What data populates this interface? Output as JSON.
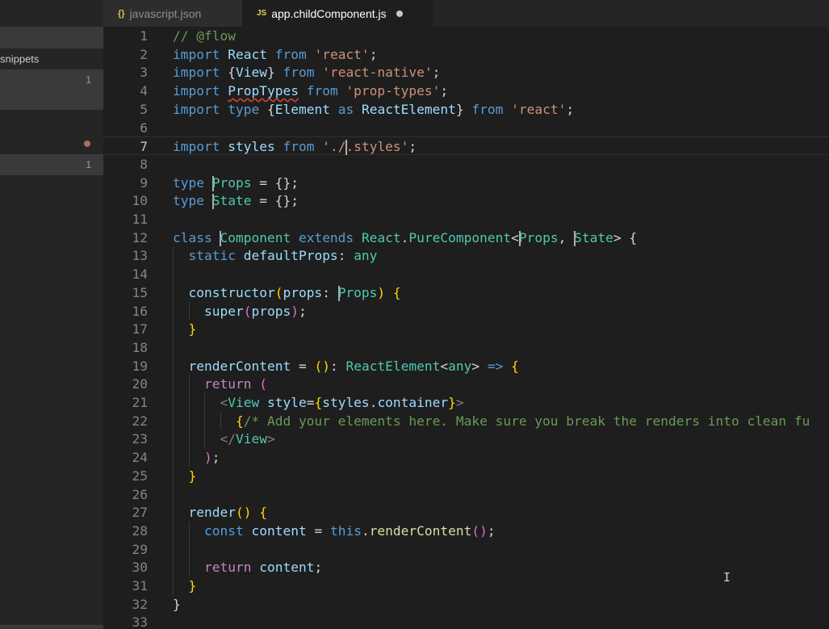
{
  "sidebar": {
    "items": [
      {
        "label": "",
        "badge": "",
        "dot": false
      },
      {
        "label": "snippets",
        "badge": "",
        "dot": false
      },
      {
        "label": "",
        "badge": "1",
        "dot": false
      },
      {
        "label": "",
        "badge": "",
        "dot": true
      },
      {
        "label": "",
        "badge": "1",
        "dot": false
      }
    ]
  },
  "tabs": [
    {
      "icon": "{}",
      "label": "javascript.json",
      "active": false
    },
    {
      "icon": "JS",
      "label": "app.childComponent.js",
      "active": true,
      "dirty": true
    }
  ],
  "editor": {
    "current_line": 7,
    "lines": [
      {
        "n": "1",
        "tokens": [
          [
            "c",
            "// @flow"
          ]
        ]
      },
      {
        "n": "2",
        "tokens": [
          [
            "k",
            "import"
          ],
          [
            "p",
            " "
          ],
          [
            "v",
            "React"
          ],
          [
            "p",
            " "
          ],
          [
            "k",
            "from"
          ],
          [
            "p",
            " "
          ],
          [
            "s",
            "'react'"
          ],
          [
            "p",
            ";"
          ]
        ]
      },
      {
        "n": "3",
        "tokens": [
          [
            "k",
            "import"
          ],
          [
            "p",
            " {"
          ],
          [
            "v",
            "View"
          ],
          [
            "p",
            "} "
          ],
          [
            "k",
            "from"
          ],
          [
            "p",
            " "
          ],
          [
            "s",
            "'react-native'"
          ],
          [
            "p",
            ";"
          ]
        ]
      },
      {
        "n": "4",
        "tokens": [
          [
            "k",
            "import"
          ],
          [
            "p",
            " "
          ],
          [
            "vq",
            "PropTypes"
          ],
          [
            "p",
            " "
          ],
          [
            "k",
            "from"
          ],
          [
            "p",
            " "
          ],
          [
            "s",
            "'prop-types'"
          ],
          [
            "p",
            ";"
          ]
        ]
      },
      {
        "n": "5",
        "tokens": [
          [
            "k",
            "import"
          ],
          [
            "p",
            " "
          ],
          [
            "k",
            "type"
          ],
          [
            "p",
            " {"
          ],
          [
            "v",
            "Element"
          ],
          [
            "p",
            " "
          ],
          [
            "k",
            "as"
          ],
          [
            "p",
            " "
          ],
          [
            "v",
            "ReactElement"
          ],
          [
            "p",
            "} "
          ],
          [
            "k",
            "from"
          ],
          [
            "p",
            " "
          ],
          [
            "s",
            "'react'"
          ],
          [
            "p",
            ";"
          ]
        ]
      },
      {
        "n": "6",
        "tokens": []
      },
      {
        "n": "7",
        "tokens": [
          [
            "k",
            "import"
          ],
          [
            "p",
            " "
          ],
          [
            "v",
            "styles"
          ],
          [
            "p",
            " "
          ],
          [
            "k",
            "from"
          ],
          [
            "p",
            " "
          ],
          [
            "s",
            "'./"
          ],
          [
            "caret",
            ""
          ],
          [
            "s",
            ".styles'"
          ],
          [
            "p",
            ";"
          ]
        ]
      },
      {
        "n": "8",
        "tokens": []
      },
      {
        "n": "9",
        "tokens": [
          [
            "k",
            "type"
          ],
          [
            "p",
            " "
          ],
          [
            "caret",
            ""
          ],
          [
            "t",
            "Props"
          ],
          [
            "p",
            " = {};"
          ]
        ]
      },
      {
        "n": "10",
        "tokens": [
          [
            "k",
            "type"
          ],
          [
            "p",
            " "
          ],
          [
            "caret",
            ""
          ],
          [
            "t",
            "State"
          ],
          [
            "p",
            " = {};"
          ]
        ]
      },
      {
        "n": "11",
        "tokens": []
      },
      {
        "n": "12",
        "tokens": [
          [
            "k",
            "class"
          ],
          [
            "p",
            " "
          ],
          [
            "caret",
            ""
          ],
          [
            "t",
            "Component"
          ],
          [
            "p",
            " "
          ],
          [
            "k",
            "extends"
          ],
          [
            "p",
            " "
          ],
          [
            "t",
            "React"
          ],
          [
            "p",
            "."
          ],
          [
            "t",
            "PureComponent"
          ],
          [
            "p",
            "<"
          ],
          [
            "caret",
            ""
          ],
          [
            "t",
            "Props"
          ],
          [
            "p",
            ", "
          ],
          [
            "caret",
            ""
          ],
          [
            "t",
            "State"
          ],
          [
            "p",
            "> {"
          ]
        ]
      },
      {
        "n": "13",
        "tokens": [
          [
            "p",
            "  "
          ],
          [
            "k",
            "static"
          ],
          [
            "p",
            " "
          ],
          [
            "v",
            "defaultProps"
          ],
          [
            "p",
            ": "
          ],
          [
            "t",
            "any"
          ]
        ]
      },
      {
        "n": "14",
        "tokens": []
      },
      {
        "n": "15",
        "tokens": [
          [
            "p",
            "  "
          ],
          [
            "v",
            "constructor"
          ],
          [
            "b",
            "("
          ],
          [
            "v",
            "props"
          ],
          [
            "p",
            ": "
          ],
          [
            "caret",
            ""
          ],
          [
            "t",
            "Props"
          ],
          [
            "b",
            ")"
          ],
          [
            "p",
            " "
          ],
          [
            "b",
            "{"
          ]
        ]
      },
      {
        "n": "16",
        "tokens": [
          [
            "p",
            "    "
          ],
          [
            "v",
            "super"
          ],
          [
            "b2",
            "("
          ],
          [
            "v",
            "props"
          ],
          [
            "b2",
            ")"
          ],
          [
            "p",
            ";"
          ]
        ]
      },
      {
        "n": "17",
        "tokens": [
          [
            "p",
            "  "
          ],
          [
            "b",
            "}"
          ]
        ]
      },
      {
        "n": "18",
        "tokens": []
      },
      {
        "n": "19",
        "tokens": [
          [
            "p",
            "  "
          ],
          [
            "v",
            "renderContent"
          ],
          [
            "p",
            " = "
          ],
          [
            "b",
            "()"
          ],
          [
            "p",
            ": "
          ],
          [
            "t",
            "ReactElement"
          ],
          [
            "p",
            "<"
          ],
          [
            "t",
            "any"
          ],
          [
            "p",
            "> "
          ],
          [
            "k",
            "=>"
          ],
          [
            "p",
            " "
          ],
          [
            "b",
            "{"
          ]
        ]
      },
      {
        "n": "20",
        "tokens": [
          [
            "p",
            "    "
          ],
          [
            "ctl",
            "return"
          ],
          [
            "p",
            " "
          ],
          [
            "b2",
            "("
          ]
        ]
      },
      {
        "n": "21",
        "tokens": [
          [
            "p",
            "      "
          ],
          [
            "g",
            "<"
          ],
          [
            "t",
            "View"
          ],
          [
            "p",
            " "
          ],
          [
            "v",
            "style"
          ],
          [
            "p",
            "="
          ],
          [
            "b",
            "{"
          ],
          [
            "v",
            "styles"
          ],
          [
            "p",
            "."
          ],
          [
            "v",
            "container"
          ],
          [
            "b",
            "}"
          ],
          [
            "g",
            ">"
          ]
        ]
      },
      {
        "n": "22",
        "tokens": [
          [
            "p",
            "        "
          ],
          [
            "b",
            "{"
          ],
          [
            "c",
            "/* Add your elements here. Make sure you break the renders into clean fu"
          ]
        ]
      },
      {
        "n": "23",
        "tokens": [
          [
            "p",
            "      "
          ],
          [
            "g",
            "</"
          ],
          [
            "t",
            "View"
          ],
          [
            "g",
            ">"
          ]
        ]
      },
      {
        "n": "24",
        "tokens": [
          [
            "p",
            "    "
          ],
          [
            "b2",
            ")"
          ],
          [
            "p",
            ";"
          ]
        ]
      },
      {
        "n": "25",
        "tokens": [
          [
            "p",
            "  "
          ],
          [
            "b",
            "}"
          ]
        ]
      },
      {
        "n": "26",
        "tokens": []
      },
      {
        "n": "27",
        "tokens": [
          [
            "p",
            "  "
          ],
          [
            "v",
            "render"
          ],
          [
            "b",
            "()"
          ],
          [
            "p",
            " "
          ],
          [
            "b",
            "{"
          ]
        ]
      },
      {
        "n": "28",
        "tokens": [
          [
            "p",
            "    "
          ],
          [
            "k",
            "const"
          ],
          [
            "p",
            " "
          ],
          [
            "v",
            "content"
          ],
          [
            "p",
            " = "
          ],
          [
            "k",
            "this"
          ],
          [
            "p",
            "."
          ],
          [
            "f",
            "renderContent"
          ],
          [
            "b2",
            "()"
          ],
          [
            "p",
            ";"
          ]
        ]
      },
      {
        "n": "29",
        "tokens": []
      },
      {
        "n": "30",
        "tokens": [
          [
            "p",
            "    "
          ],
          [
            "ctl",
            "return"
          ],
          [
            "p",
            " "
          ],
          [
            "v",
            "content"
          ],
          [
            "p",
            ";"
          ]
        ]
      },
      {
        "n": "31",
        "tokens": [
          [
            "p",
            "  "
          ],
          [
            "b",
            "}"
          ]
        ]
      },
      {
        "n": "32",
        "tokens": [
          [
            "p",
            "}"
          ]
        ]
      },
      {
        "n": "33",
        "tokens": []
      }
    ]
  },
  "colors": {
    "background": "#1e1e1e",
    "sidebar": "#252526",
    "keyword": "#569cd6",
    "string": "#ce9178",
    "type": "#4ec9b0",
    "comment": "#6a9955"
  }
}
